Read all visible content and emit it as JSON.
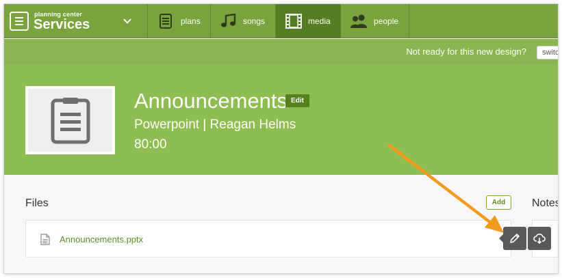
{
  "app": {
    "brand_small": "planning center",
    "brand_name": "Services"
  },
  "nav": {
    "tabs": [
      {
        "label": "plans",
        "icon": "document-icon"
      },
      {
        "label": "songs",
        "icon": "music-note-icon"
      },
      {
        "label": "media",
        "icon": "film-icon",
        "active": true
      },
      {
        "label": "people",
        "icon": "people-icon"
      }
    ]
  },
  "notice": {
    "text": "Not ready for this new design?",
    "button_label": "switc"
  },
  "media": {
    "title": "Announcements",
    "edit_label": "Edit",
    "subtitle": "Powerpoint | Reagan Helms",
    "duration": "80:00"
  },
  "files": {
    "heading": "Files",
    "add_label": "Add",
    "items": [
      {
        "name": "Announcements.pptx"
      }
    ]
  },
  "notes": {
    "heading": "Notes"
  },
  "colors": {
    "nav_green": "#79a33d",
    "hero_green": "#8ebd52",
    "annotation_arrow": "#f39a1e",
    "action_button": "#595959"
  }
}
